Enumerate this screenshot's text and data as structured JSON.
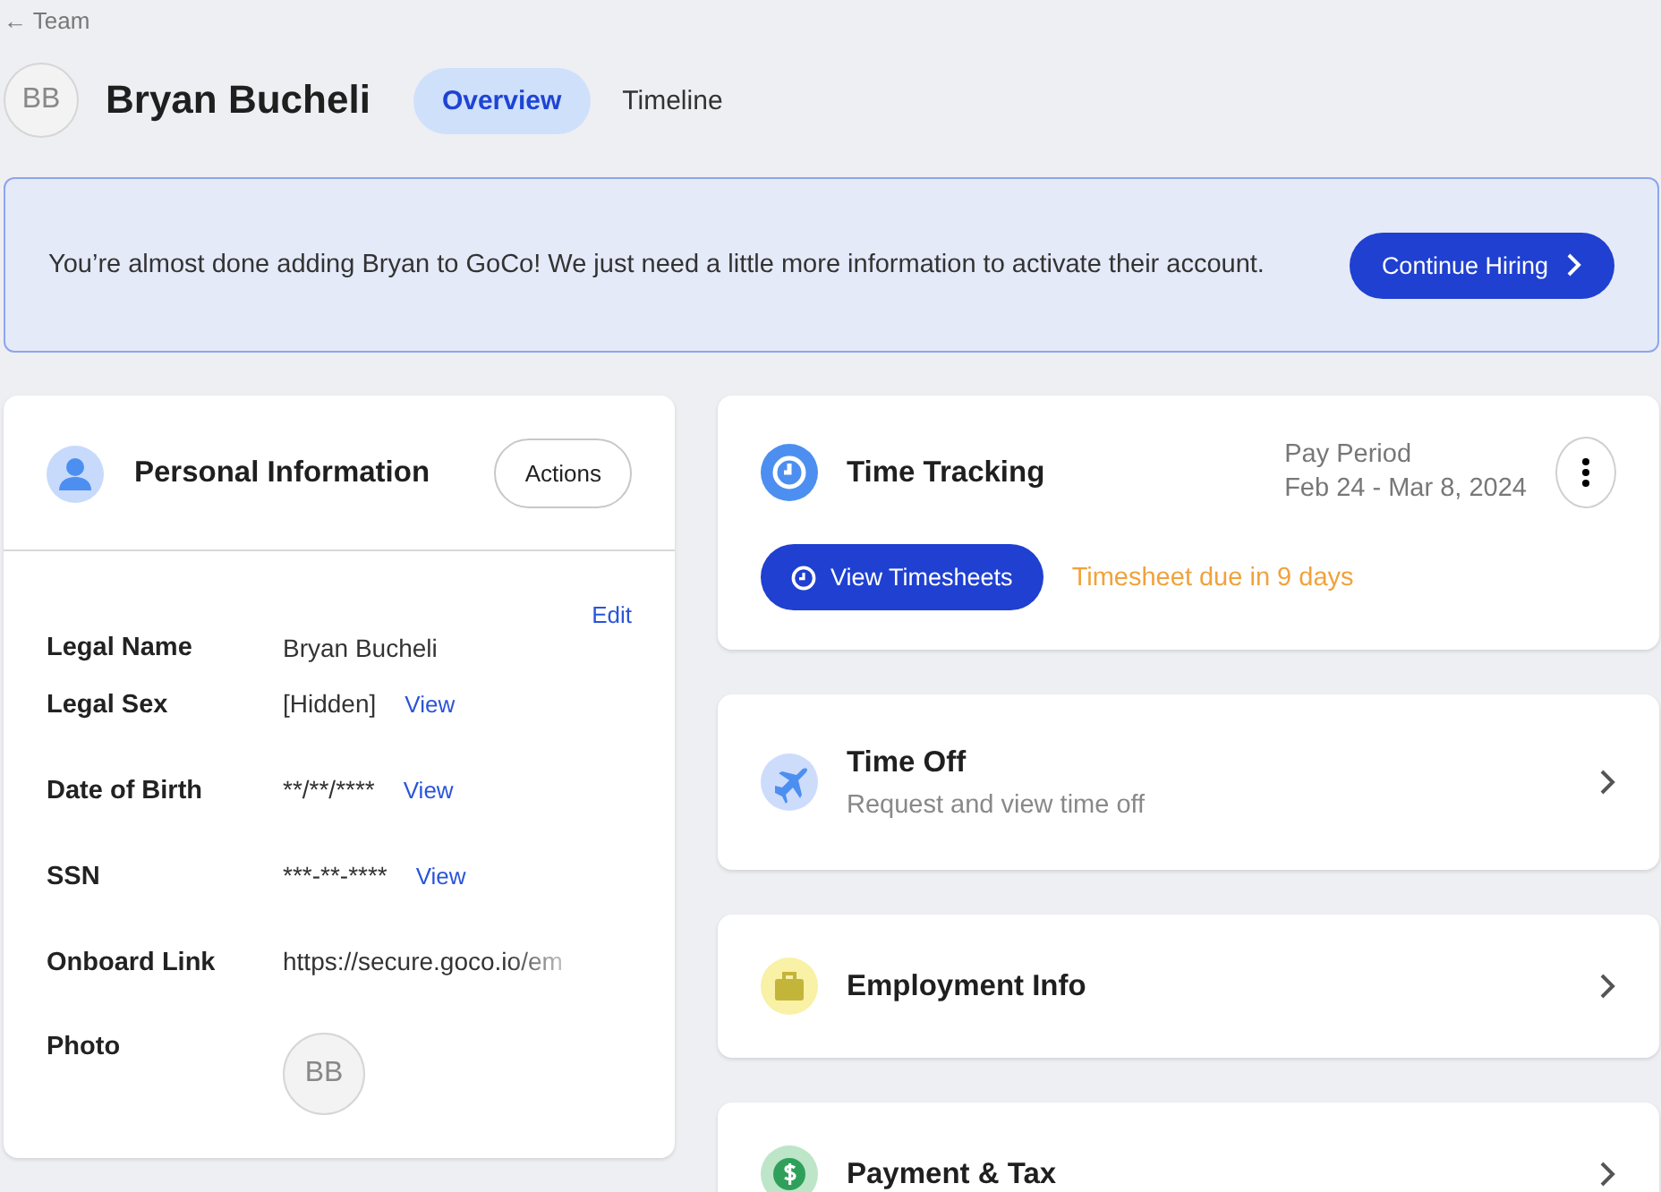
{
  "back_link": {
    "arrow": "←",
    "label": "Team"
  },
  "profile": {
    "initials": "BB",
    "name": "Bryan Bucheli"
  },
  "tabs": [
    {
      "label": "Overview",
      "selected": true
    },
    {
      "label": "Timeline",
      "selected": false
    }
  ],
  "banner": {
    "message": "You’re almost done adding Bryan to GoCo! We just need a little more information to activate their account.",
    "button": "Continue Hiring"
  },
  "personal_info": {
    "title": "Personal Information",
    "actions_button": "Actions",
    "edit_link": "Edit",
    "fields": [
      {
        "kind": "text",
        "label": "Legal Name",
        "value": "Bryan Bucheli"
      },
      {
        "kind": "text",
        "label": "Legal Sex",
        "value": "[Hidden]",
        "action": "View"
      },
      {
        "kind": "text",
        "label": "Date of Birth",
        "value": "**/**/****",
        "action": "View"
      },
      {
        "kind": "text",
        "label": "SSN",
        "value": "***-**-****",
        "action": "View"
      },
      {
        "kind": "link",
        "label": "Onboard Link",
        "value": "https://secure.goco.io/em"
      },
      {
        "kind": "photo",
        "label": "Photo",
        "value": "BB"
      }
    ]
  },
  "time_tracking": {
    "title": "Time Tracking",
    "period_label": "Pay Period",
    "period": "Feb 24 - Mar 8, 2024",
    "button": "View Timesheets",
    "due_note": "Timesheet due in 9 days"
  },
  "sections": [
    {
      "kind": "time_off",
      "title": "Time Off",
      "subtitle": "Request and view time off"
    },
    {
      "kind": "employment",
      "title": "Employment Info"
    },
    {
      "kind": "payment",
      "title": "Payment & Tax"
    }
  ]
}
